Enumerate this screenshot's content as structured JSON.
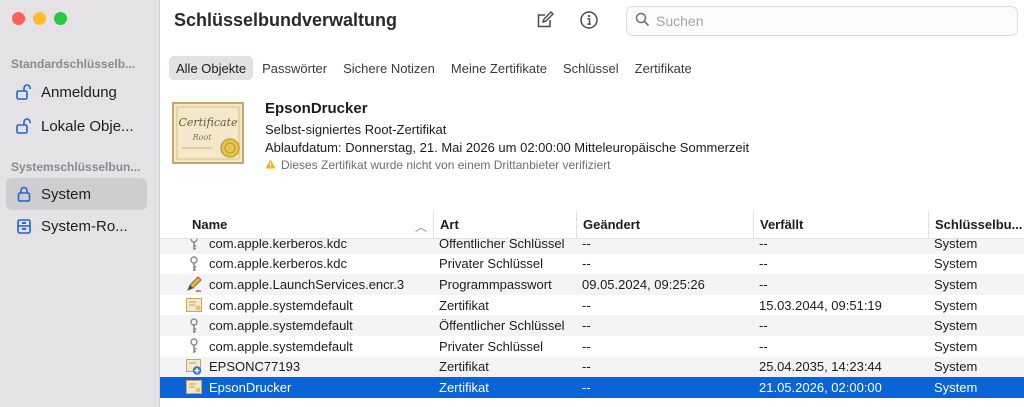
{
  "window": {
    "title": "Schlüsselbundverwaltung"
  },
  "sidebar": {
    "section1": "Standardschlüsselb...",
    "section2": "Systemschlüsselbun...",
    "items": [
      {
        "label": "Anmeldung",
        "icon": "lock-open-icon"
      },
      {
        "label": "Lokale Obje...",
        "icon": "lock-open-icon"
      },
      {
        "label": "System",
        "icon": "lock-icon"
      },
      {
        "label": "System-Ro...",
        "icon": "cabinet-icon"
      }
    ]
  },
  "toolbar": {
    "search_placeholder": "Suchen"
  },
  "filters": [
    "Alle Objekte",
    "Passwörter",
    "Sichere Notizen",
    "Meine Zertifikate",
    "Schlüssel",
    "Zertifikate"
  ],
  "cert": {
    "name": "EpsonDrucker",
    "type": "Selbst-signiertes Root-Zertifikat",
    "expiry": "Ablaufdatum: Donnerstag, 21. Mai 2026 um 02:00:00 Mitteleuropäische Sommerzeit",
    "warning": "Dieses Zertifikat wurde nicht von einem Drittanbieter verifiziert",
    "image_word1": "Certificate",
    "image_word2": "Root"
  },
  "table": {
    "headers": [
      "Name",
      "Art",
      "Geändert",
      "Verfällt",
      "Schlüsselbu..."
    ],
    "rows": [
      {
        "name": "com.apple.kerberos.kdc",
        "art": "Öffentlicher Schlüssel",
        "mod": "--",
        "exp": "--",
        "kc": "System",
        "icon": "key-icon"
      },
      {
        "name": "com.apple.kerberos.kdc",
        "art": "Privater Schlüssel",
        "mod": "--",
        "exp": "--",
        "kc": "System",
        "icon": "key-icon"
      },
      {
        "name": "com.apple.LaunchServices.encr.3",
        "art": "Programmpasswort",
        "mod": "09.05.2024, 09:25:26",
        "exp": "--",
        "kc": "System",
        "icon": "pen-icon"
      },
      {
        "name": "com.apple.systemdefault",
        "art": "Zertifikat",
        "mod": "--",
        "exp": "15.03.2044, 09:51:19",
        "kc": "System",
        "icon": "certificate-icon"
      },
      {
        "name": "com.apple.systemdefault",
        "art": "Öffentlicher Schlüssel",
        "mod": "--",
        "exp": "--",
        "kc": "System",
        "icon": "key-icon"
      },
      {
        "name": "com.apple.systemdefault",
        "art": "Privater Schlüssel",
        "mod": "--",
        "exp": "--",
        "kc": "System",
        "icon": "key-icon"
      },
      {
        "name": "EPSONC77193",
        "art": "Zertifikat",
        "mod": "--",
        "exp": "25.04.2035, 14:23:44",
        "kc": "System",
        "icon": "certificate-plus-icon"
      },
      {
        "name": "EpsonDrucker",
        "art": "Zertifikat",
        "mod": "--",
        "exp": "21.05.2026, 02:00:00",
        "kc": "System",
        "icon": "certificate-icon"
      }
    ]
  },
  "colors": {
    "selection": "#0a63d7",
    "sidebar_bg": "#e4e2e4",
    "accent": "#0a63d7"
  }
}
